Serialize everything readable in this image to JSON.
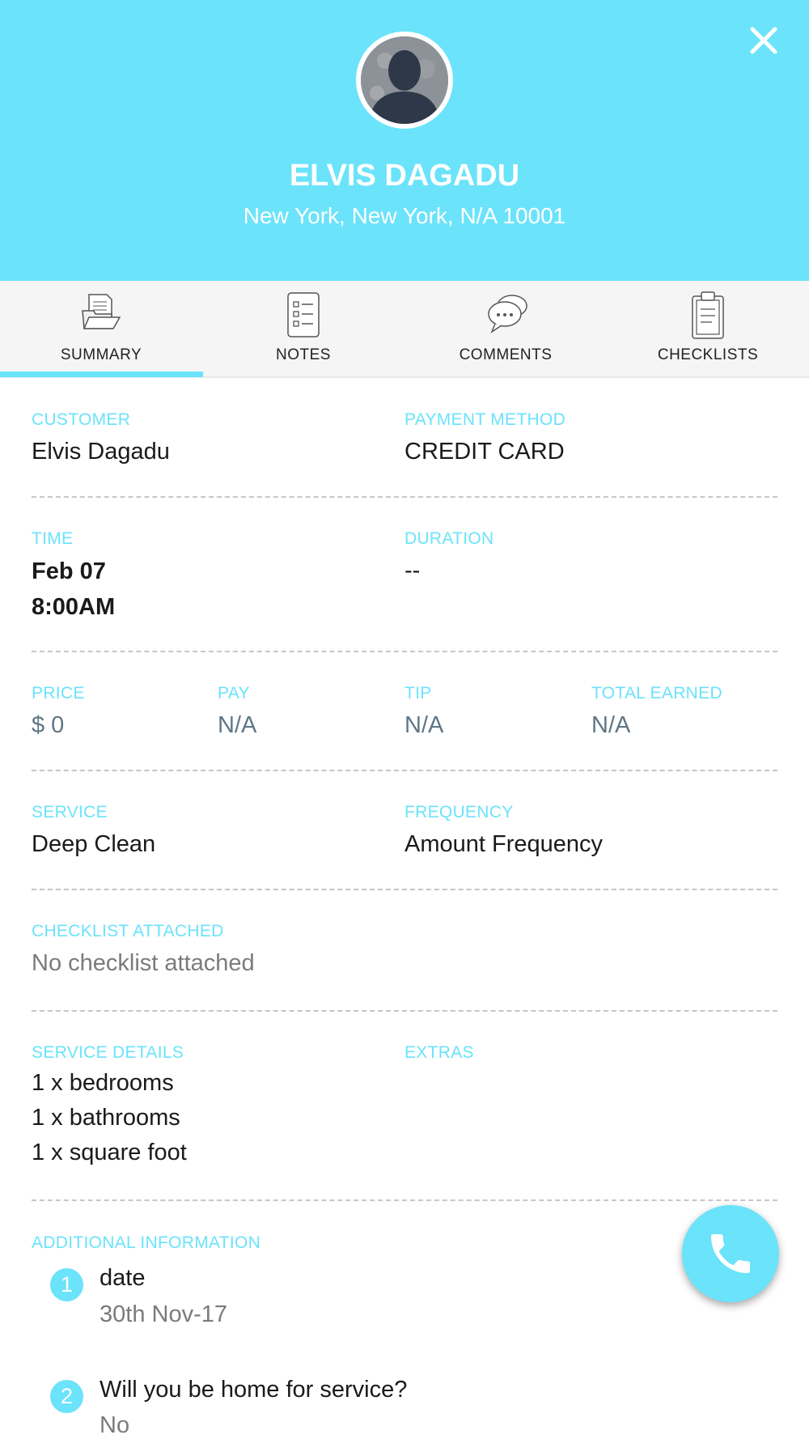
{
  "header": {
    "name": "ELVIS DAGADU",
    "address": "New York, New York, N/A 10001",
    "background_color": "#6be3fb",
    "close_icon": "close-icon",
    "avatar_icon": "person-silhouette-icon"
  },
  "tabs": [
    {
      "label": "SUMMARY",
      "icon": "folder-icon",
      "active": true
    },
    {
      "label": "NOTES",
      "icon": "notes-list-icon",
      "active": false
    },
    {
      "label": "COMMENTS",
      "icon": "chat-bubbles-icon",
      "active": false
    },
    {
      "label": "CHECKLISTS",
      "icon": "clipboard-icon",
      "active": false
    }
  ],
  "summary": {
    "customer": {
      "label": "CUSTOMER",
      "value": "Elvis Dagadu"
    },
    "payment_method": {
      "label": "PAYMENT METHOD",
      "value": "CREDIT CARD"
    },
    "time": {
      "label": "TIME",
      "date": "Feb 07",
      "time": "8:00AM"
    },
    "duration": {
      "label": "DURATION",
      "value": "--"
    },
    "price": {
      "label": "PRICE",
      "value": "$ 0"
    },
    "pay": {
      "label": "PAY",
      "value": "N/A"
    },
    "tip": {
      "label": "TIP",
      "value": "N/A"
    },
    "total_earned": {
      "label": "TOTAL EARNED",
      "value": "N/A"
    },
    "service": {
      "label": "SERVICE",
      "value": "Deep Clean"
    },
    "frequency": {
      "label": "FREQUENCY",
      "value": "Amount Frequency"
    },
    "checklist_attached": {
      "label": "CHECKLIST ATTACHED",
      "value": "No checklist attached"
    },
    "service_details": {
      "label": "SERVICE DETAILS",
      "items": [
        "1 x bedrooms",
        "1 x bathrooms",
        "1 x square foot"
      ]
    },
    "extras": {
      "label": "EXTRAS"
    },
    "additional_information": {
      "label": "ADDITIONAL INFORMATION",
      "items": [
        {
          "number": "1",
          "question": "date",
          "answer": "30th Nov-17"
        },
        {
          "number": "2",
          "question": "Will you be home for service?",
          "answer": "No"
        }
      ]
    }
  },
  "call_button": {
    "icon": "phone-icon"
  },
  "colors": {
    "accent": "#6be3fb",
    "label": "#6be3fb",
    "value_dark": "#1a1a1a",
    "value_slate": "#5f7685",
    "value_grey": "#7b7b7b"
  }
}
